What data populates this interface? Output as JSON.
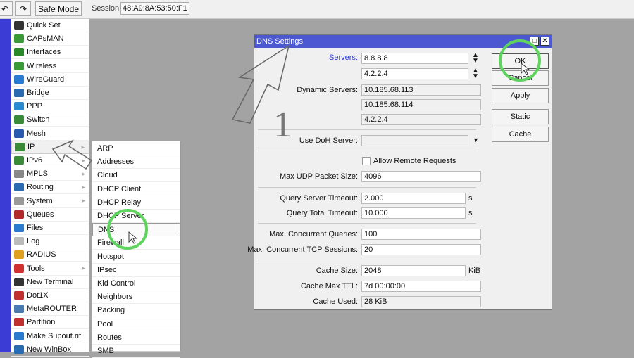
{
  "toolbar": {
    "undo_icon": "undo-icon",
    "redo_icon": "redo-icon",
    "safe_mode": "Safe Mode",
    "session_label": "Session:",
    "session_value": "48:A9:8A:53:50:F1"
  },
  "menu": [
    {
      "label": "Quick Set",
      "icon": "wand",
      "color": "#333"
    },
    {
      "label": "CAPsMAN",
      "icon": "antenna",
      "color": "#3a9a3a"
    },
    {
      "label": "Interfaces",
      "icon": "interfaces",
      "color": "#2a8a2a"
    },
    {
      "label": "Wireless",
      "icon": "antenna",
      "color": "#3a9a3a"
    },
    {
      "label": "WireGuard",
      "icon": "wireguard",
      "color": "#2a7ad0"
    },
    {
      "label": "Bridge",
      "icon": "bridge",
      "color": "#2a6ab0"
    },
    {
      "label": "PPP",
      "icon": "ppp",
      "color": "#2a8ad0"
    },
    {
      "label": "Switch",
      "icon": "switch",
      "color": "#3a8a3a"
    },
    {
      "label": "Mesh",
      "icon": "mesh",
      "color": "#2a5ab0"
    },
    {
      "label": "IP",
      "icon": "ip",
      "color": "#3a8a3a",
      "submenu": true
    },
    {
      "label": "IPv6",
      "icon": "ipv6",
      "color": "#3a8a3a",
      "submenu": true
    },
    {
      "label": "MPLS",
      "icon": "mpls",
      "color": "#888",
      "submenu": true
    },
    {
      "label": "Routing",
      "icon": "routing",
      "color": "#2a6ab0",
      "submenu": true
    },
    {
      "label": "System",
      "icon": "gear",
      "color": "#999",
      "submenu": true
    },
    {
      "label": "Queues",
      "icon": "queues",
      "color": "#b02a2a"
    },
    {
      "label": "Files",
      "icon": "folder",
      "color": "#2a7ad0"
    },
    {
      "label": "Log",
      "icon": "log",
      "color": "#bbb"
    },
    {
      "label": "RADIUS",
      "icon": "users",
      "color": "#e0a020"
    },
    {
      "label": "Tools",
      "icon": "tools",
      "color": "#d03030",
      "submenu": true
    },
    {
      "label": "New Terminal",
      "icon": "terminal",
      "color": "#333"
    },
    {
      "label": "Dot1X",
      "icon": "dot1x",
      "color": "#c03030"
    },
    {
      "label": "MetaROUTER",
      "icon": "metarouter",
      "color": "#4a7ab0"
    },
    {
      "label": "Partition",
      "icon": "partition",
      "color": "#c03030"
    },
    {
      "label": "Make Supout.rif",
      "icon": "supout",
      "color": "#2a7ad0"
    },
    {
      "label": "New WinBox",
      "icon": "winbox",
      "color": "#2a6ab0"
    }
  ],
  "submenu": [
    "ARP",
    "Addresses",
    "Cloud",
    "DHCP Client",
    "DHCP Relay",
    "DHCP Server",
    "DNS",
    "Firewall",
    "Hotspot",
    "IPsec",
    "Kid Control",
    "Neighbors",
    "Packing",
    "Pool",
    "Routes",
    "SMB"
  ],
  "dialog": {
    "title": "DNS Settings",
    "servers_label": "Servers:",
    "servers": [
      "8.8.8.8",
      "4.2.2.4"
    ],
    "dynamic_label": "Dynamic Servers:",
    "dynamic": [
      "10.185.68.113",
      "10.185.68.114",
      "4.2.2.4"
    ],
    "doh_label": "Use DoH Server:",
    "doh_value": "",
    "allow_remote": "Allow Remote Requests",
    "allow_remote_checked": false,
    "udp_label": "Max UDP Packet Size:",
    "udp_value": "4096",
    "qst_label": "Query Server Timeout:",
    "qst_value": "2.000",
    "qst_unit": "s",
    "qtt_label": "Query Total Timeout:",
    "qtt_value": "10.000",
    "qtt_unit": "s",
    "mcq_label": "Max. Concurrent Queries:",
    "mcq_value": "100",
    "mct_label": "Max. Concurrent TCP Sessions:",
    "mct_value": "20",
    "cs_label": "Cache Size:",
    "cs_value": "2048",
    "cs_unit": "KiB",
    "ttl_label": "Cache Max TTL:",
    "ttl_value": "7d 00:00:00",
    "cu_label": "Cache Used:",
    "cu_value": "28 KiB",
    "buttons": {
      "ok": "OK",
      "cancel": "Cancel",
      "apply": "Apply",
      "static": "Static",
      "cache": "Cache"
    }
  },
  "annotation": {
    "step_number": "1",
    "highlight_color": "#5ed35e"
  }
}
